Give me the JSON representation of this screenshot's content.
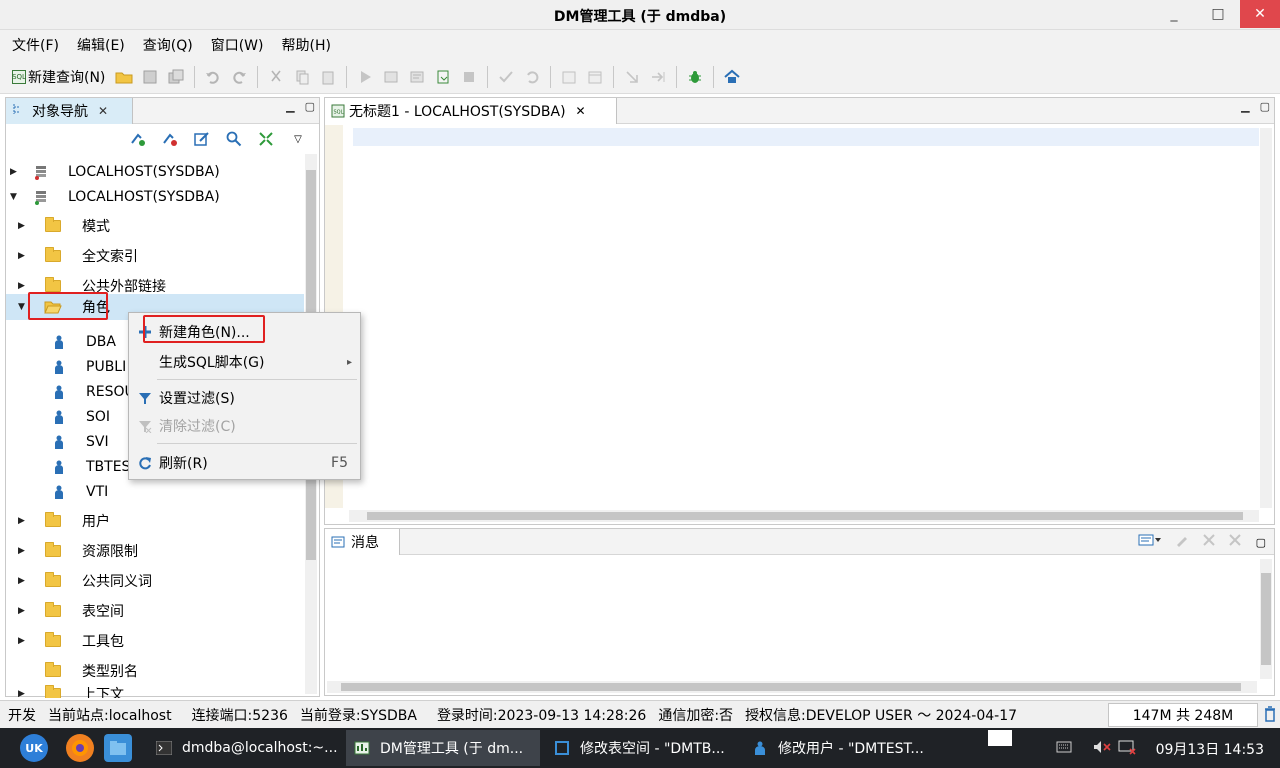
{
  "window": {
    "title": "DM管理工具 (于 dmdba)",
    "minimize": "_",
    "maximize": "□",
    "close": "✕"
  },
  "menubar": [
    "文件(F)",
    "编辑(E)",
    "查询(Q)",
    "窗口(W)",
    "帮助(H)"
  ],
  "toolbar": {
    "new_query_label": "新建查询(N)",
    "sql_badge": "SQL"
  },
  "navigator": {
    "tab_label": "对象导航",
    "tab_close": "✕",
    "tree": [
      {
        "label": "LOCALHOST(SYSDBA)",
        "arrow": "▶"
      },
      {
        "label": "LOCALHOST(SYSDBA)",
        "arrow": "▼"
      },
      {
        "label": "模式",
        "arrow": "▶"
      },
      {
        "label": "全文索引",
        "arrow": "▶"
      },
      {
        "label": "公共外部链接",
        "arrow": "▶"
      },
      {
        "label": "角色",
        "arrow": "▼"
      },
      {
        "label": "DBA"
      },
      {
        "label": "PUBLI"
      },
      {
        "label": "RESOU"
      },
      {
        "label": "SOI"
      },
      {
        "label": "SVI"
      },
      {
        "label": "TBTES"
      },
      {
        "label": "VTI"
      },
      {
        "label": "用户",
        "arrow": "▶"
      },
      {
        "label": "资源限制",
        "arrow": "▶"
      },
      {
        "label": "公共同义词",
        "arrow": "▶"
      },
      {
        "label": "表空间",
        "arrow": "▶"
      },
      {
        "label": "工具包",
        "arrow": "▶"
      },
      {
        "label": "类型别名"
      },
      {
        "label": "上下文",
        "arrow": "▶"
      }
    ]
  },
  "context_menu": {
    "items": [
      {
        "label": "新建角色(N)...",
        "icon": "plus-icon"
      },
      {
        "label": "生成SQL脚本(G)",
        "submenu_arrow": "▸"
      },
      {
        "label": "设置过滤(S)",
        "icon": "filter-icon"
      },
      {
        "label": "清除过滤(C)",
        "icon": "clear-filter-icon",
        "disabled": true
      },
      {
        "label": "刷新(R)",
        "icon": "refresh-icon",
        "shortcut": "F5"
      }
    ]
  },
  "editor": {
    "tab_label": "无标题1 - LOCALHOST(SYSDBA)",
    "tab_close": "✕"
  },
  "messages": {
    "tab_label": "消息"
  },
  "statusbar": {
    "mode": "开发",
    "site": "当前站点:localhost",
    "port": "连接端口:5236",
    "login": "当前登录:SYSDBA",
    "login_time": "登录时间:2023-09-13 14:28:26",
    "encryption": "通信加密:否",
    "license": "授权信息:DEVELOP USER ～ 2024-04-17",
    "memory": "147M 共 248M"
  },
  "taskbar": {
    "launcher_label": "UK",
    "tasks": [
      {
        "label": "dmdba@localhost:~..."
      },
      {
        "label": "DM管理工具 (于 dm..."
      },
      {
        "label": "修改表空间 - \"DMTB..."
      },
      {
        "label": "修改用户 - \"DMTEST..."
      }
    ],
    "clock": "09月13日 14:53"
  },
  "colors": {
    "accent": "#2a6fb5",
    "selection": "#cfe6f6",
    "highlight_box": "#e02020",
    "folder": "#f2c544",
    "close_button": "#e0474c"
  }
}
